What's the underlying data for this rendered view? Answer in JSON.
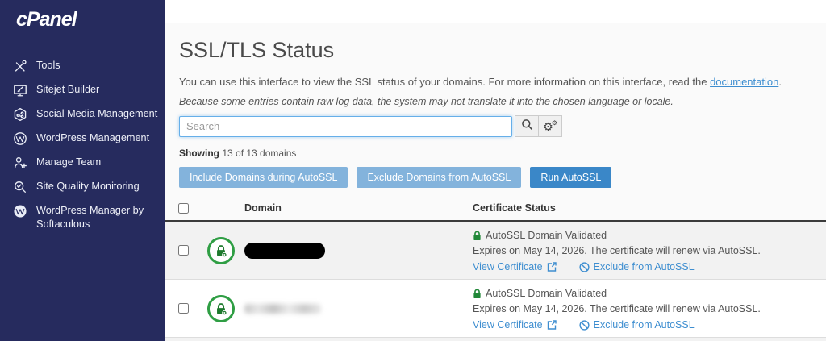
{
  "colors": {
    "sidebar_bg": "#262b5e",
    "primary_blue": "#3a87c8",
    "disabled_blue": "#83b3dc",
    "link_blue": "#3e8ed0",
    "success_green": "#2f9e44"
  },
  "sidebar": {
    "logo": "cPanel",
    "items": [
      {
        "label": "Tools",
        "icon": "tools-icon"
      },
      {
        "label": "Sitejet Builder",
        "icon": "sitejet-icon"
      },
      {
        "label": "Social Media Management",
        "icon": "social-media-icon"
      },
      {
        "label": "WordPress Management",
        "icon": "wordpress-icon"
      },
      {
        "label": "Manage Team",
        "icon": "manage-team-icon"
      },
      {
        "label": "Site Quality Monitoring",
        "icon": "site-quality-icon"
      },
      {
        "label": "WordPress Manager by Softaculous",
        "icon": "wordpress-manager-icon"
      }
    ]
  },
  "main": {
    "title": "SSL/TLS Status",
    "description": {
      "text_before_link": "You can use this interface to view the SSL status of your domains. For more information on this interface, read the ",
      "link_text": "documentation",
      "text_after_link": "."
    },
    "locale_note": "Because some entries contain raw log data, the system may not translate it into the chosen language or locale.",
    "search": {
      "placeholder": "Search",
      "value": ""
    },
    "showing": {
      "label": "Showing",
      "text": " 13 of 13 domains"
    },
    "actions": [
      {
        "label": "Include Domains during AutoSSL"
      },
      {
        "label": "Exclude Domains from AutoSSL"
      },
      {
        "label": "Run AutoSSL"
      }
    ],
    "table": {
      "columns": [
        "Domain",
        "Certificate Status"
      ],
      "rows": [
        {
          "domain_display": "redacted-blackout",
          "status_badge": "AutoSSL Domain Validated",
          "status_detail": "Expires on May 14, 2026. The certificate will renew via AutoSSL.",
          "link_view": "View Certificate",
          "link_exclude": "Exclude from AutoSSL"
        },
        {
          "domain_display": "redacted-blur",
          "status_badge": "AutoSSL Domain Validated",
          "status_detail": "Expires on May 14, 2026. The certificate will renew via AutoSSL.",
          "link_view": "View Certificate",
          "link_exclude": "Exclude from AutoSSL"
        }
      ]
    }
  }
}
